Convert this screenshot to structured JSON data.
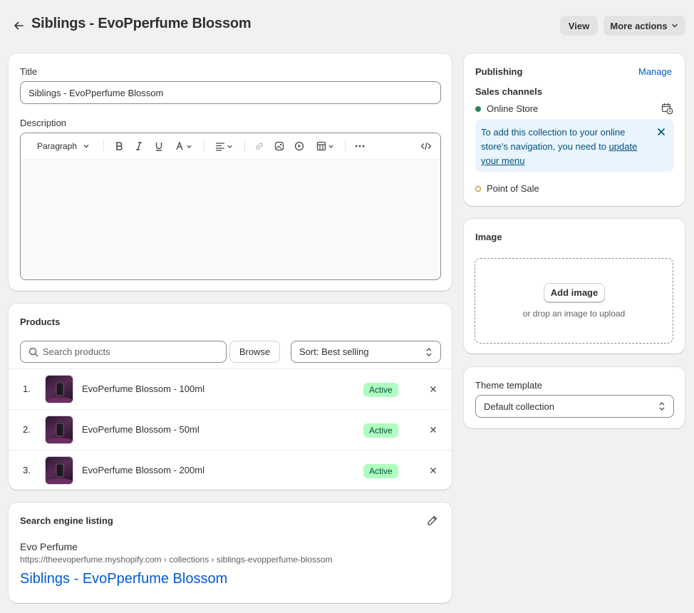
{
  "header": {
    "title": "Siblings - EvoPperfume Blossom",
    "view_label": "View",
    "more_actions_label": "More actions"
  },
  "details": {
    "title_label": "Title",
    "title_value": "Siblings - EvoPperfume Blossom",
    "description_label": "Description",
    "paragraph_label": "Paragraph"
  },
  "products": {
    "heading": "Products",
    "search_placeholder": "Search products",
    "browse_label": "Browse",
    "sort_label": "Sort: Best selling",
    "items": [
      {
        "index": "1.",
        "name": "EvoPerfume Blossom - 100ml",
        "status": "Active"
      },
      {
        "index": "2.",
        "name": "EvoPerfume Blossom - 50ml",
        "status": "Active"
      },
      {
        "index": "3.",
        "name": "EvoPerfume Blossom - 200ml",
        "status": "Active"
      }
    ]
  },
  "seo": {
    "heading": "Search engine listing",
    "store_name": "Evo Perfume",
    "url": "https://theevoperfume.myshopify.com › collections › siblings-evopperfume-blossom",
    "page_title": "Siblings - EvoPperfume Blossom"
  },
  "publishing": {
    "heading": "Publishing",
    "manage_label": "Manage",
    "sales_channels_label": "Sales channels",
    "online_store_label": "Online Store",
    "banner_text": "To add this collection to your online store's navigation, you need to",
    "banner_link": "update your menu",
    "pos_label": "Point of Sale",
    "online_store_status_color": "#29845a",
    "pos_status_color": "#b28400"
  },
  "image": {
    "heading": "Image",
    "add_image_label": "Add image",
    "drop_hint": "or drop an image to upload"
  },
  "theme": {
    "heading": "Theme template",
    "selected": "Default collection"
  }
}
